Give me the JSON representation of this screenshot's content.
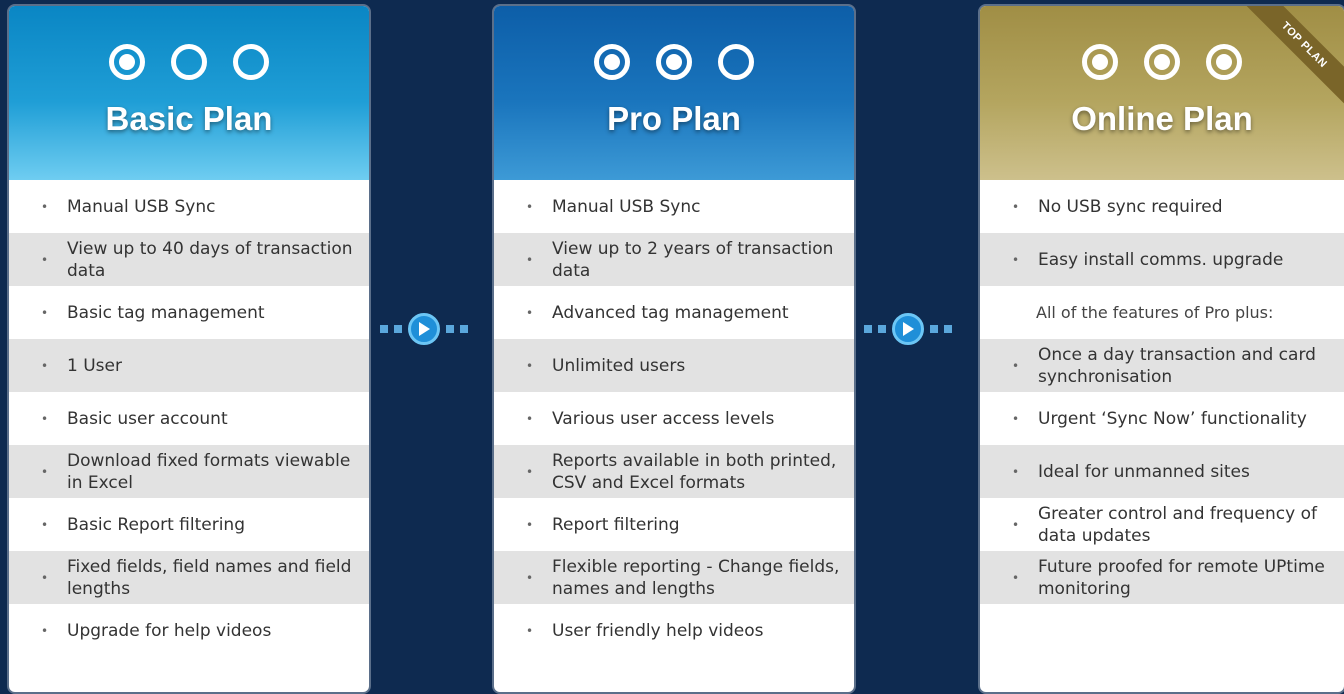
{
  "plans": [
    {
      "title": "Basic Plan",
      "dots_filled": 1,
      "features": [
        {
          "text": "Manual USB Sync"
        },
        {
          "text": "View up to 40 days of transaction data"
        },
        {
          "text": "Basic tag management"
        },
        {
          "text": "1 User"
        },
        {
          "text": "Basic user account"
        },
        {
          "text": "Download fixed formats viewable in Excel"
        },
        {
          "text": "Basic Report filtering"
        },
        {
          "text": "Fixed fields, field names and field lengths"
        },
        {
          "text": "Upgrade for help videos"
        }
      ]
    },
    {
      "title": "Pro Plan",
      "dots_filled": 2,
      "features": [
        {
          "text": "Manual USB Sync"
        },
        {
          "text": "View up to 2 years of transaction data"
        },
        {
          "text": "Advanced tag management"
        },
        {
          "text": "Unlimited users"
        },
        {
          "text": "Various user access levels"
        },
        {
          "text": "Reports available in both printed, CSV and Excel formats"
        },
        {
          "text": "Report filtering"
        },
        {
          "text": "Flexible reporting - Change fields, names and lengths"
        },
        {
          "text": "User friendly help videos"
        }
      ]
    },
    {
      "title": "Online Plan",
      "dots_filled": 3,
      "ribbon": "TOP PLAN",
      "features": [
        {
          "text": "No USB sync required"
        },
        {
          "text": "Easy install comms. upgrade"
        },
        {
          "text": "All of the features of Pro plus:"
        },
        {
          "text": "Once a day transaction and card synchronisation"
        },
        {
          "text": "Urgent ‘Sync Now’ functionality"
        },
        {
          "text": "Ideal for unmanned sites"
        },
        {
          "text": "Greater control and frequency of data updates"
        },
        {
          "text": "Future proofed for remote UPtime monitoring"
        }
      ]
    }
  ],
  "icons": {
    "bullet": "•",
    "connector": "play-arrow-icon"
  },
  "colors": {
    "background": "#0e2a50",
    "basic_header": "#1f9ed6",
    "pro_header": "#1a75bd",
    "online_header": "#b4a55f",
    "shaded_row": "#e2e2e2",
    "connector": "#1f8fd8"
  }
}
